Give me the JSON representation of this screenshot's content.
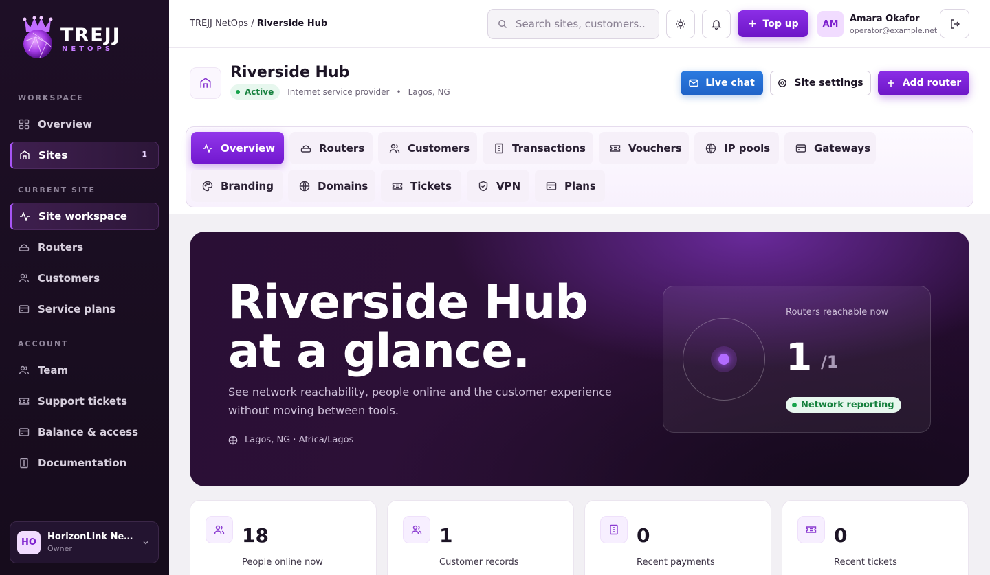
{
  "brand": {
    "name": "TREJJ",
    "sub": "NETOPS"
  },
  "sidebar": {
    "sections": {
      "workspace": "WORKSPACE",
      "current_site": "CURRENT SITE",
      "account": "ACCOUNT"
    },
    "workspace_items": [
      {
        "label": "Overview",
        "icon": "grid-icon"
      },
      {
        "label": "Sites",
        "icon": "building-icon",
        "badge": "1",
        "active": true
      }
    ],
    "site_items": [
      {
        "label": "Site workspace",
        "icon": "activity-icon",
        "active": true
      },
      {
        "label": "Routers",
        "icon": "router-icon"
      },
      {
        "label": "Customers",
        "icon": "users-icon"
      },
      {
        "label": "Service plans",
        "icon": "card-icon"
      }
    ],
    "account_items": [
      {
        "label": "Team",
        "icon": "users-icon"
      },
      {
        "label": "Support tickets",
        "icon": "ticket-icon"
      },
      {
        "label": "Balance & access",
        "icon": "wallet-icon"
      },
      {
        "label": "Documentation",
        "icon": "doc-icon"
      }
    ],
    "org": {
      "initials": "HO",
      "name": "HorizonLink Net...",
      "role": "Owner"
    }
  },
  "topbar": {
    "breadcrumb_root": "TREJJ NetOps",
    "breadcrumb_sep": "/",
    "breadcrumb_current": "Riverside Hub",
    "search_placeholder": "Search sites, customers...",
    "topup_label": "Top up",
    "user": {
      "initials": "AM",
      "name": "Amara Okafor",
      "email": "operator@example.net"
    }
  },
  "site": {
    "name": "Riverside Hub",
    "status": "Active",
    "type": "Internet service provider",
    "location": "Lagos, NG",
    "buttons": {
      "chat": "Live chat",
      "settings": "Site settings",
      "add": "Add router"
    }
  },
  "tabs": [
    {
      "label": "Overview",
      "icon": "activity-icon",
      "active": true
    },
    {
      "label": "Routers",
      "icon": "router-icon"
    },
    {
      "label": "Customers",
      "icon": "users-icon"
    },
    {
      "label": "Transactions",
      "icon": "receipt-icon"
    },
    {
      "label": "Vouchers",
      "icon": "ticket-icon"
    },
    {
      "label": "IP pools",
      "icon": "globe-icon"
    },
    {
      "label": "Gateways",
      "icon": "card-icon"
    },
    {
      "label": "Branding",
      "icon": "palette-icon"
    },
    {
      "label": "Domains",
      "icon": "globe-icon"
    },
    {
      "label": "Tickets",
      "icon": "ticket-icon"
    },
    {
      "label": "VPN",
      "icon": "shield-icon"
    },
    {
      "label": "Plans",
      "icon": "card-icon"
    }
  ],
  "hero": {
    "title_line1": "Riverside Hub",
    "title_line2": "at a glance.",
    "description": "See network reachability, people online and the customer experience without moving between tools.",
    "location": "Lagos, NG · Africa/Lagos",
    "reach_label": "Routers reachable now",
    "reach_value": "1",
    "reach_total": "/1",
    "reach_status": "Network reporting"
  },
  "stats": [
    {
      "value": "18",
      "label": "People online now",
      "icon": "users-icon"
    },
    {
      "value": "1",
      "label": "Customer records",
      "icon": "users-icon"
    },
    {
      "value": "0",
      "label": "Recent payments",
      "icon": "receipt-icon"
    },
    {
      "value": "0",
      "label": "Recent tickets",
      "icon": "ticket-icon"
    }
  ],
  "colors": {
    "accent": "#7e22ce",
    "sidebar_bg": "#1e0f26",
    "hero_bg": "#2a0f35",
    "success": "#16a34a",
    "chat_blue": "#1f62c7"
  }
}
